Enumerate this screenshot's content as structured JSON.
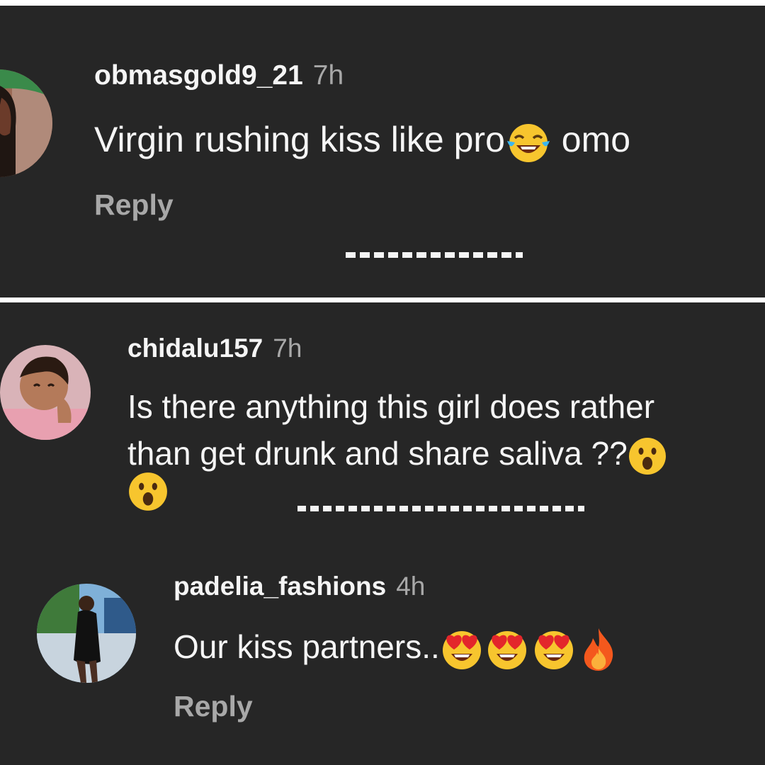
{
  "comments": [
    {
      "username": "obmasgold9_21",
      "time": "7h",
      "text_before": "Virgin rushing kiss like pro",
      "emoji_1": "tears-of-joy-emoji",
      "text_after": " omo",
      "reply_label": "Reply"
    },
    {
      "username": "chidalu157",
      "time": "7h",
      "line_1": "Is there anything this girl does rather",
      "line_2": "than get drunk and share saliva ??",
      "emoji_1": "open-mouth-emoji",
      "emoji_2": "open-mouth-emoji"
    },
    {
      "username": "padelia_fashions",
      "time": "4h",
      "text": "Our kiss partners..",
      "emojis": [
        "heart-eyes-emoji",
        "heart-eyes-emoji",
        "heart-eyes-emoji",
        "fire-emoji"
      ],
      "reply_label": "Reply"
    }
  ],
  "colors": {
    "background": "#262626",
    "text": "#f5f5f5",
    "secondary": "#a8a8a8",
    "divider": "#ffffff"
  }
}
